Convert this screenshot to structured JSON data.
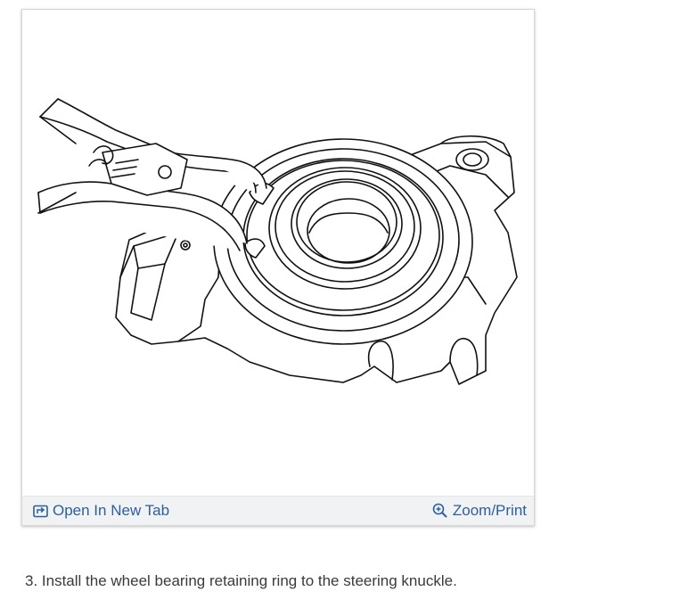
{
  "figure": {
    "open_new_tab_label": "Open In New Tab",
    "zoom_print_label": "Zoom/Print",
    "open_icon": "open-new-tab-icon",
    "zoom_icon": "zoom-icon",
    "link_color": "#2b5f9e"
  },
  "step": {
    "text": "3. Install the wheel bearing retaining ring to the steering knuckle."
  }
}
